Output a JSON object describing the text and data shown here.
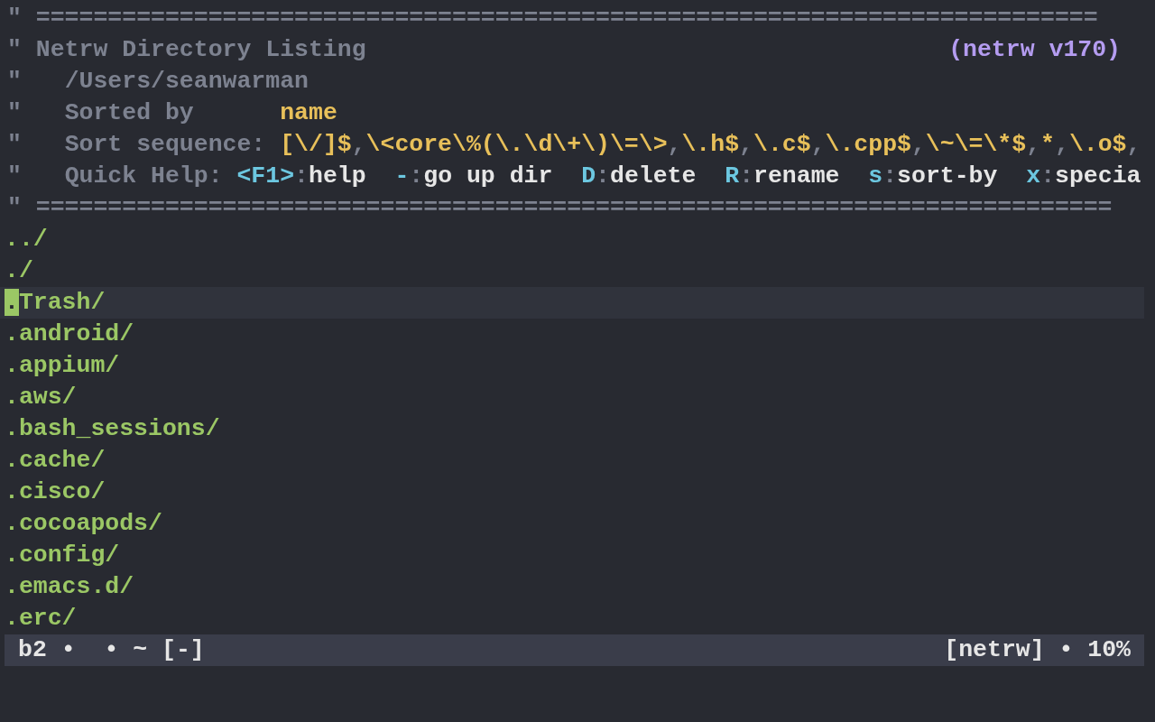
{
  "banner": {
    "comment_mark": "\"",
    "rule_top": "==========================================================================",
    "title": "Netrw Directory Listing",
    "version": "(netrw v170)",
    "path": "/Users/seanwarman",
    "sorted_by_label": "Sorted by",
    "sorted_by_value": "name",
    "sort_sequence_label": "Sort sequence:",
    "sort_sequence": [
      {
        "text": "[\\/]$",
        "kind": "pattern"
      },
      {
        "text": ",",
        "kind": "separator"
      },
      {
        "text": "\\<core\\%(\\.\\d\\+\\)\\=\\>",
        "kind": "pattern"
      },
      {
        "text": ",",
        "kind": "separator"
      },
      {
        "text": "\\.h$",
        "kind": "pattern"
      },
      {
        "text": ",",
        "kind": "separator"
      },
      {
        "text": "\\.c$",
        "kind": "pattern"
      },
      {
        "text": ",",
        "kind": "separator"
      },
      {
        "text": "\\.cpp$",
        "kind": "pattern"
      },
      {
        "text": ",",
        "kind": "separator"
      },
      {
        "text": "\\~\\=\\*$",
        "kind": "pattern"
      },
      {
        "text": ",",
        "kind": "separator"
      },
      {
        "text": "*",
        "kind": "pattern"
      },
      {
        "text": ",",
        "kind": "separator"
      },
      {
        "text": "\\.o$",
        "kind": "pattern"
      },
      {
        "text": ",",
        "kind": "separator"
      }
    ],
    "quick_help_label": "Quick Help:",
    "quick_help": [
      {
        "key": "<F1>",
        "sep": ":",
        "action": "help"
      },
      {
        "key": "-",
        "sep": ":",
        "action": "go up dir"
      },
      {
        "key": "D",
        "sep": ":",
        "action": "delete"
      },
      {
        "key": "R",
        "sep": ":",
        "action": "rename"
      },
      {
        "key": "s",
        "sep": ":",
        "action": "sort-by"
      },
      {
        "key": "x",
        "sep": ":",
        "action": "specia"
      }
    ],
    "rule_bottom": "==========================================================================="
  },
  "entries": [
    {
      "name": "../",
      "selected": false
    },
    {
      "name": "./",
      "selected": false
    },
    {
      "name": ".Trash/",
      "selected": true
    },
    {
      "name": ".android/",
      "selected": false
    },
    {
      "name": ".appium/",
      "selected": false
    },
    {
      "name": ".aws/",
      "selected": false
    },
    {
      "name": ".bash_sessions/",
      "selected": false
    },
    {
      "name": ".cache/",
      "selected": false
    },
    {
      "name": ".cisco/",
      "selected": false
    },
    {
      "name": ".cocoapods/",
      "selected": false
    },
    {
      "name": ".config/",
      "selected": false
    },
    {
      "name": ".emacs.d/",
      "selected": false
    },
    {
      "name": ".erc/",
      "selected": false
    }
  ],
  "status_bar": {
    "left": "b2 •  • ~ [-]",
    "right": "[netrw] • 10%"
  }
}
